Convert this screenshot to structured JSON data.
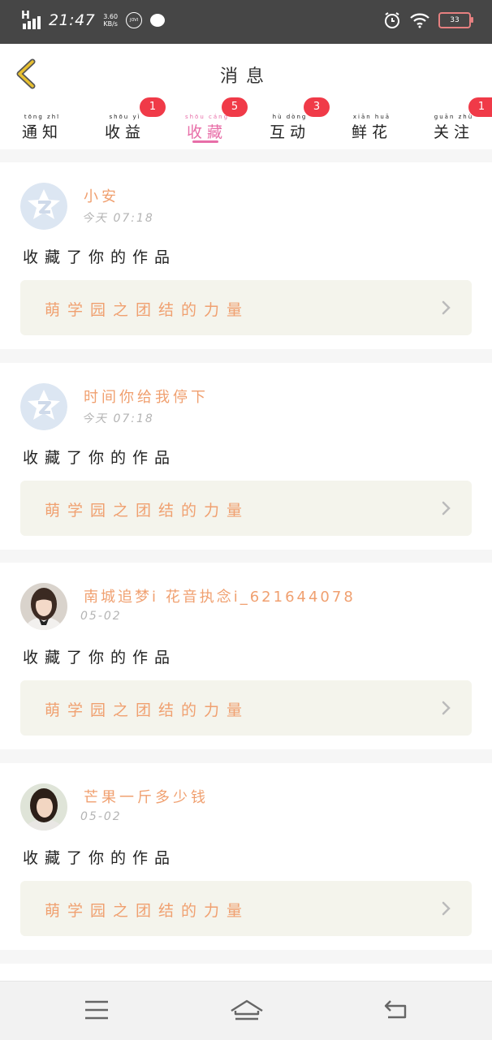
{
  "status": {
    "net": "H",
    "time": "21:47",
    "speed_value": "3.60",
    "speed_unit": "KB/s",
    "jovi": "JOVI",
    "battery": "33"
  },
  "header": {
    "title": "消息"
  },
  "tabs": [
    {
      "label": "通知",
      "pinyin": "tōng zhī"
    },
    {
      "label": "收益",
      "pinyin": "shōu yì",
      "badge": "1"
    },
    {
      "label": "收藏",
      "pinyin": "shōu cáng",
      "badge": "5",
      "active": true
    },
    {
      "label": "互动",
      "pinyin": "hù dòng",
      "badge": "3"
    },
    {
      "label": "鲜花",
      "pinyin": "xiān huā"
    },
    {
      "label": "关注",
      "pinyin": "guān zhù",
      "badge": "1"
    }
  ],
  "notifications": [
    {
      "user": "小安",
      "date": "今天 07:18",
      "action": "收藏了你的作品",
      "work": "萌学园之团结的力量",
      "avatar": "default"
    },
    {
      "user": "时间你给我停下",
      "date": "今天 07:18",
      "action": "收藏了你的作品",
      "work": "萌学园之团结的力量",
      "avatar": "default"
    },
    {
      "user": "南城追梦i 花音执念i_621644078",
      "date": "05-02",
      "action": "收藏了你的作品",
      "work": "萌学园之团结的力量",
      "avatar": "photo1"
    },
    {
      "user": "芒果一斤多少钱",
      "date": "05-02",
      "action": "收藏了你的作品",
      "work": "萌学园之团结的力量",
      "avatar": "photo2"
    }
  ],
  "colors": {
    "accent": "#e86ea8",
    "badge": "#f03a48",
    "name": "#f0a070",
    "back_arrow": "#e8c030"
  }
}
